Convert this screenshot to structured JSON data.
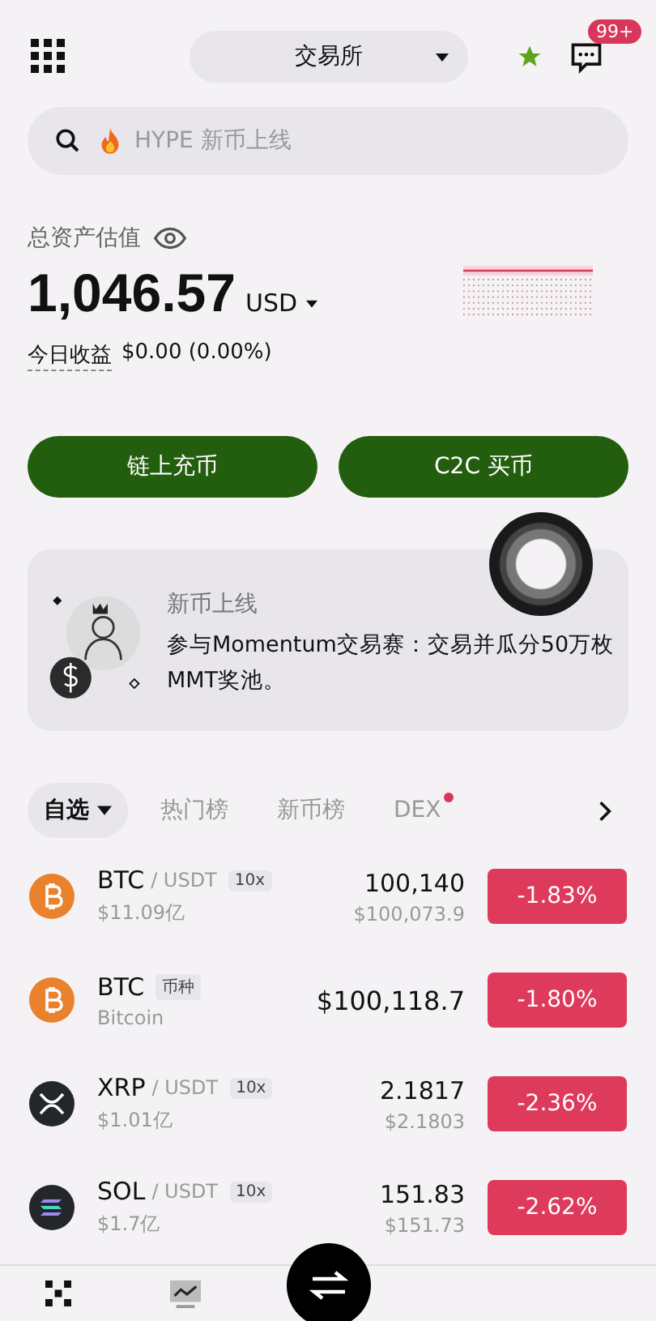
{
  "header": {
    "exchange_selector": "交易所",
    "notification_badge": "99+"
  },
  "search": {
    "placeholder": "HYPE 新币上线"
  },
  "assets": {
    "label": "总资产估值",
    "value": "1,046.57",
    "currency": "USD",
    "today_label": "今日收益",
    "today_value": "$0.00 (0.00%)"
  },
  "actions": [
    "链上充币",
    "C2C 买币"
  ],
  "banner": {
    "title": "新币上线",
    "text": "参与Momentum交易赛：交易并瓜分50万枚MMT奖池。"
  },
  "tabs": [
    {
      "label": "自选",
      "selected": true,
      "dropdown": true,
      "dot": false
    },
    {
      "label": "热门榜",
      "selected": false,
      "dropdown": false,
      "dot": false
    },
    {
      "label": "新币榜",
      "selected": false,
      "dropdown": false,
      "dot": false
    },
    {
      "label": "DEX",
      "selected": false,
      "dropdown": false,
      "dot": true
    }
  ],
  "rows": [
    {
      "kind": "pair",
      "icon": {
        "kind": "bitcoin"
      },
      "symbol": "BTC",
      "quote": "/ USDT",
      "tag": "10x",
      "sub": "$11.09亿",
      "price": "100,140",
      "price_sub": "$100,073.9",
      "change": "-1.83%"
    },
    {
      "kind": "coin",
      "icon": {
        "kind": "bitcoin"
      },
      "symbol": "BTC",
      "tag": "币种",
      "sub": "Bitcoin",
      "price": "$100,118.7",
      "change": "-1.80%"
    },
    {
      "kind": "pair",
      "icon": {
        "kind": "xrp"
      },
      "symbol": "XRP",
      "quote": "/ USDT",
      "tag": "10x",
      "sub": "$1.01亿",
      "price": "2.1817",
      "price_sub": "$2.1803",
      "change": "-2.36%"
    },
    {
      "kind": "pair",
      "icon": {
        "kind": "solana"
      },
      "symbol": "SOL",
      "quote": "/ USDT",
      "tag": "10x",
      "sub": "$1.7亿",
      "price": "151.83",
      "price_sub": "$151.73",
      "change": "-2.62%"
    }
  ]
}
